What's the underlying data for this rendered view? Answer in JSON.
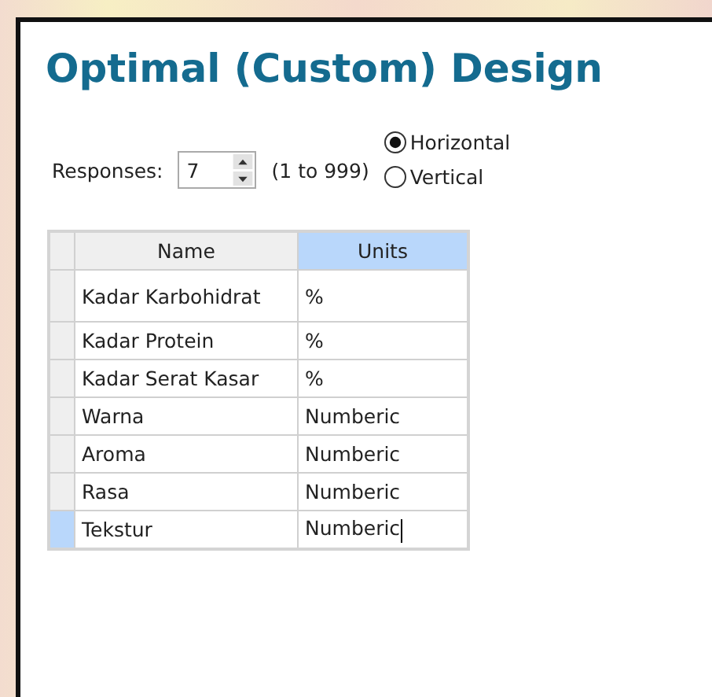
{
  "title": "Optimal (Custom) Design",
  "responses": {
    "label": "Responses:",
    "value": "7",
    "range": "(1 to 999)"
  },
  "orientation": [
    {
      "label": "Horizontal",
      "selected": true
    },
    {
      "label": "Vertical",
      "selected": false
    }
  ],
  "table": {
    "columns": [
      {
        "label": "Name",
        "selected": false
      },
      {
        "label": "Units",
        "selected": true
      }
    ],
    "rows": [
      {
        "name": "Kadar Karbohidrat",
        "units": "%",
        "selected": false
      },
      {
        "name": "Kadar Protein",
        "units": "%",
        "selected": false
      },
      {
        "name": "Kadar Serat Kasar",
        "units": "%",
        "selected": false
      },
      {
        "name": "Warna",
        "units": "Numberic",
        "selected": false
      },
      {
        "name": "Aroma",
        "units": "Numberic",
        "selected": false
      },
      {
        "name": "Rasa",
        "units": "Numberic",
        "selected": false
      },
      {
        "name": "Tekstur",
        "units": "Numberic",
        "selected": true
      }
    ]
  }
}
